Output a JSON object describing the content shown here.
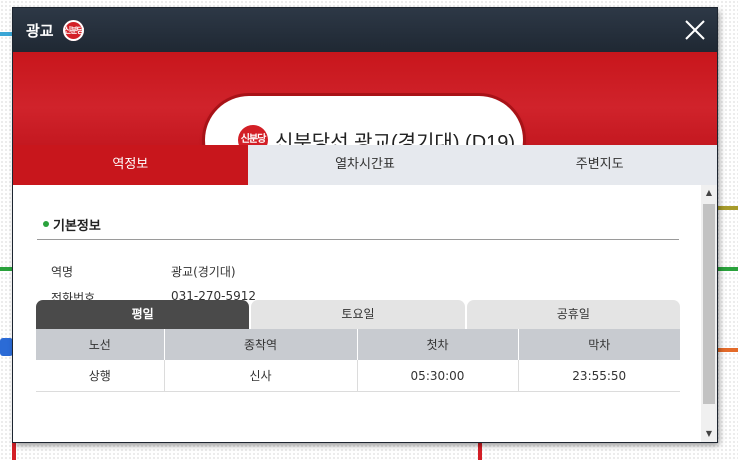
{
  "window": {
    "title": "광교",
    "line_logo_text": "신분당",
    "close_label": "닫기"
  },
  "station": {
    "logo_text": "신분당",
    "name": "신분당선 광교(경기대) (D19)"
  },
  "tabs": [
    {
      "label": "역정보",
      "active": true
    },
    {
      "label": "열차시간표",
      "active": false
    },
    {
      "label": "주변지도",
      "active": false
    }
  ],
  "basic_info": {
    "title": "기본정보",
    "rows": [
      {
        "label": "역명",
        "value": "광교(경기대)"
      },
      {
        "label": "전화번호",
        "value": "031-270-5912"
      }
    ]
  },
  "schedule": {
    "day_tabs": [
      {
        "label": "평일",
        "active": true
      },
      {
        "label": "토요일",
        "active": false
      },
      {
        "label": "공휴일",
        "active": false
      }
    ],
    "columns": [
      "노선",
      "종착역",
      "첫차",
      "막차"
    ],
    "rows": [
      [
        "상행",
        "신사",
        "05:30:00",
        "23:55:50"
      ]
    ]
  },
  "colors": {
    "line_red": "#c8161c",
    "titlebar_dark": "#1f2833",
    "bullet_green": "#2aa23c"
  },
  "icons": {
    "close": "close-icon",
    "scroll_up": "scroll-up-arrow-icon",
    "scroll_down": "scroll-down-arrow-icon"
  }
}
